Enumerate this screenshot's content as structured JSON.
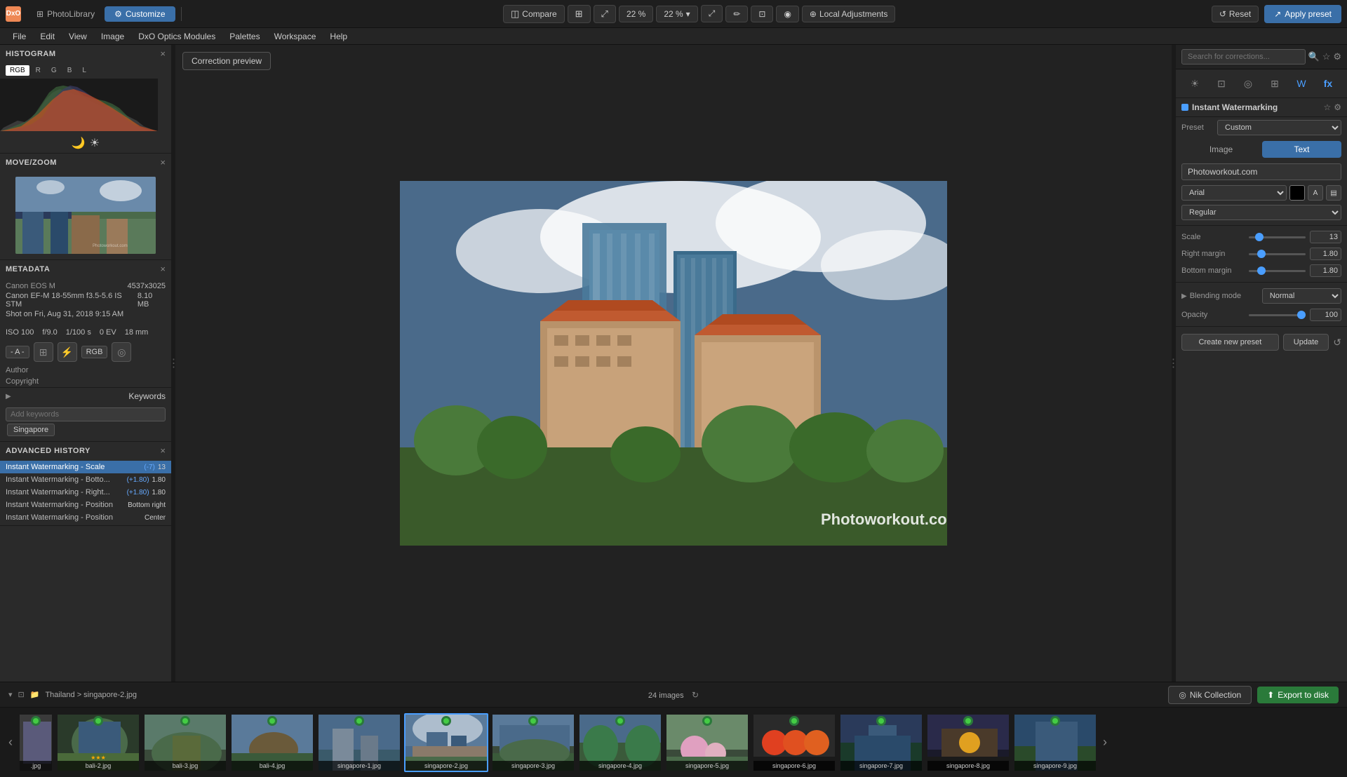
{
  "app": {
    "logo_icon": "DxO",
    "logo_text": "PhotoLibrary",
    "tab_photo_library": "PhotoLibrary",
    "tab_customize": "Customize"
  },
  "menubar": {
    "items": [
      "File",
      "Edit",
      "View",
      "Image",
      "DxO Optics Modules",
      "Palettes",
      "Workspace",
      "Help"
    ]
  },
  "toolbar": {
    "compare_label": "Compare",
    "zoom_label": "22 %",
    "local_adjustments": "Local Adjustments",
    "apply_preset": "Apply preset",
    "reset": "Reset"
  },
  "correction_preview_btn": "Correction preview",
  "left_panel": {
    "histogram": {
      "title": "HISTOGRAM",
      "tabs": [
        "RGB",
        "R",
        "G",
        "B",
        "L"
      ]
    },
    "move_zoom": {
      "title": "MOVE/ZOOM"
    },
    "metadata": {
      "title": "METADATA",
      "camera": "Canon EOS M",
      "resolution": "4537x3025",
      "lens": "Canon EF-M 18-55mm f3.5-5.6 IS STM",
      "filesize": "8.10 MB",
      "shot_date": "Shot on Fri, Aug 31, 2018 9:15 AM",
      "iso": "ISO 100",
      "aperture": "f/9.0",
      "shutter": "1/100 s",
      "ev": "0 EV",
      "focal": "18 mm",
      "mode": "- A -",
      "rgb_label": "RGB",
      "author_label": "Author",
      "author_val": "",
      "copyright_label": "Copyright",
      "copyright_val": ""
    },
    "keywords": {
      "title": "Keywords",
      "placeholder": "Add keywords",
      "tags": [
        "Singapore"
      ]
    },
    "advanced_history": {
      "title": "ADVANCED HISTORY",
      "items": [
        {
          "label": "Instant Watermarking - Scale",
          "delta": "(-7)",
          "value": "13",
          "selected": true
        },
        {
          "label": "Instant Watermarking - Botto...",
          "delta": "(+1.80)",
          "value": "1.80",
          "selected": false
        },
        {
          "label": "Instant Watermarking - Right...",
          "delta": "(+1.80)",
          "value": "1.80",
          "selected": false
        },
        {
          "label": "Instant Watermarking - Position",
          "delta": "",
          "value": "Bottom right",
          "selected": false
        },
        {
          "label": "Instant Watermarking - Position",
          "delta": "",
          "value": "Center",
          "selected": false
        }
      ]
    }
  },
  "right_panel": {
    "search_placeholder": "Search for corrections...",
    "section_title": "Instant Watermarking",
    "preset_label": "Preset",
    "preset_value": "Custom",
    "tab_image": "Image",
    "tab_text": "Text",
    "text_input_value": "Photoworkout.com",
    "font_value": "Arial",
    "style_value": "Regular",
    "scale_label": "Scale",
    "scale_value": "13",
    "scale_percent": 13,
    "right_margin_label": "Right margin",
    "right_margin_value": "1.80",
    "right_margin_percent": 18,
    "bottom_margin_label": "Bottom margin",
    "bottom_margin_value": "1.80",
    "bottom_margin_percent": 18,
    "blending_mode_label": "Blending mode",
    "blending_mode_value": "Normal",
    "opacity_label": "Opacity",
    "opacity_value": "100",
    "opacity_percent": 100,
    "create_preset_btn": "Create new preset",
    "update_btn": "Update"
  },
  "status_bar": {
    "path": "Thailand > singapore-2.jpg",
    "images_count": "24 images",
    "nik_collection": "Nik Collection",
    "export_to_disk": "Export to disk"
  },
  "filmstrip": {
    "thumbs": [
      {
        "label": ".jpg",
        "id": "t0"
      },
      {
        "label": "bali-2.jpg",
        "id": "t1"
      },
      {
        "label": "bali-3.jpg",
        "id": "t2"
      },
      {
        "label": "bali-4.jpg",
        "id": "t3"
      },
      {
        "label": "singapore-1.jpg",
        "id": "t4"
      },
      {
        "label": "singapore-2.jpg",
        "id": "t5",
        "selected": true
      },
      {
        "label": "singapore-3.jpg",
        "id": "t6"
      },
      {
        "label": "singapore-4.jpg",
        "id": "t7"
      },
      {
        "label": "singapore-5.jpg",
        "id": "t8"
      },
      {
        "label": "singapore-6.jpg",
        "id": "t9"
      },
      {
        "label": "singapore-7.jpg",
        "id": "t10"
      },
      {
        "label": "singapore-8.jpg",
        "id": "t11"
      },
      {
        "label": "singapore-9.jpg",
        "id": "t12"
      }
    ]
  }
}
